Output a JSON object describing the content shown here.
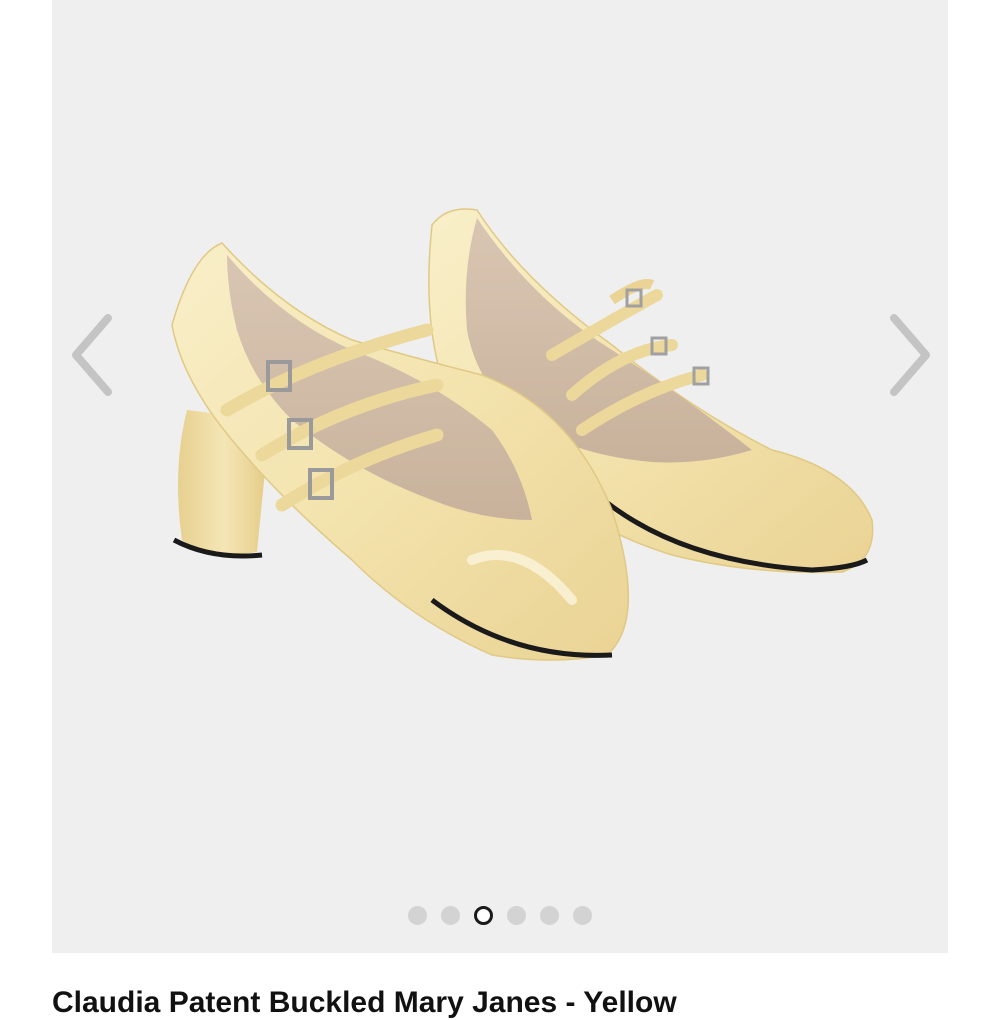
{
  "gallery": {
    "background": "#efefef",
    "product_image_alt": "Claudia Patent Buckled Mary Janes - Yellow",
    "prev_icon": "chevron-left-icon",
    "next_icon": "chevron-right-icon",
    "slides_total": 6,
    "active_slide": 3,
    "shoe_color": "#f6e8b8"
  },
  "product": {
    "title": "Claudia Patent Buckled Mary Janes - Yellow"
  }
}
